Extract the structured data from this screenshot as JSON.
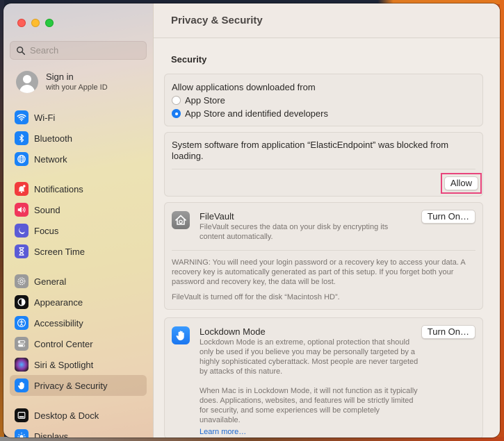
{
  "window": {
    "traffic_lights": [
      "close",
      "minimize",
      "zoom"
    ]
  },
  "sidebar": {
    "search": {
      "placeholder": "Search",
      "value": ""
    },
    "account": {
      "title": "Sign in",
      "subtitle": "with your Apple ID"
    },
    "groups": [
      [
        {
          "id": "wifi",
          "label": "Wi-Fi",
          "icon": "wifi-icon",
          "color": "#1a82f7"
        },
        {
          "id": "bluetooth",
          "label": "Bluetooth",
          "icon": "bluetooth-icon",
          "color": "#1a82f7"
        },
        {
          "id": "network",
          "label": "Network",
          "icon": "globe-icon",
          "color": "#1a82f7"
        }
      ],
      [
        {
          "id": "notifications",
          "label": "Notifications",
          "icon": "bell-icon",
          "color": "#f23c3c"
        },
        {
          "id": "sound",
          "label": "Sound",
          "icon": "speaker-icon",
          "color": "#f0365a"
        },
        {
          "id": "focus",
          "label": "Focus",
          "icon": "moon-icon",
          "color": "#5b5bd6"
        },
        {
          "id": "screen-time",
          "label": "Screen Time",
          "icon": "hourglass-icon",
          "color": "#5b5bd6"
        }
      ],
      [
        {
          "id": "general",
          "label": "General",
          "icon": "gear-icon",
          "color": "#9a9a9a"
        },
        {
          "id": "appearance",
          "label": "Appearance",
          "icon": "appearance-icon",
          "color": "#111111"
        },
        {
          "id": "accessibility",
          "label": "Accessibility",
          "icon": "accessibility-icon",
          "color": "#1a82f7"
        },
        {
          "id": "control-center",
          "label": "Control Center",
          "icon": "toggles-icon",
          "color": "#9a9a9a"
        },
        {
          "id": "siri",
          "label": "Siri & Spotlight",
          "icon": "siri-icon",
          "color": "#3a2a4a"
        },
        {
          "id": "privacy",
          "label": "Privacy & Security",
          "icon": "hand-icon",
          "color": "#1a82f7",
          "selected": true
        }
      ],
      [
        {
          "id": "desktop-dock",
          "label": "Desktop & Dock",
          "icon": "dock-icon",
          "color": "#111111"
        },
        {
          "id": "displays",
          "label": "Displays",
          "icon": "sun-icon",
          "color": "#1a82f7"
        }
      ]
    ]
  },
  "main": {
    "title": "Privacy & Security",
    "security": {
      "heading": "Security",
      "allow_from": {
        "label": "Allow applications downloaded from",
        "options": [
          {
            "label": "App Store",
            "checked": false
          },
          {
            "label": "App Store and identified developers",
            "checked": true
          }
        ]
      },
      "blocked": {
        "message": "System software from application “ElasticEndpoint” was blocked from loading.",
        "button": "Allow",
        "highlight_color": "#e8457c"
      },
      "filevault": {
        "title": "FileVault",
        "description": "FileVault secures the data on your disk by encrypting its content automatically.",
        "button": "Turn On…",
        "warning": "WARNING: You will need your login password or a recovery key to access your data. A recovery key is automatically generated as part of this setup. If you forget both your password and recovery key, the data will be lost.",
        "status": "FileVault is turned off for the disk “Macintosh HD”."
      },
      "lockdown": {
        "title": "Lockdown Mode",
        "description": "Lockdown Mode is an extreme, optional protection that should only be used if you believe you may be personally targeted by a highly sophisticated cyberattack. Most people are never targeted by attacks of this nature.",
        "description2": "When Mac is in Lockdown Mode, it will not function as it typically does. Applications, websites, and features will be strictly limited for security, and some experiences will be completely unavailable.",
        "link": "Learn more…",
        "button": "Turn On…"
      }
    }
  }
}
